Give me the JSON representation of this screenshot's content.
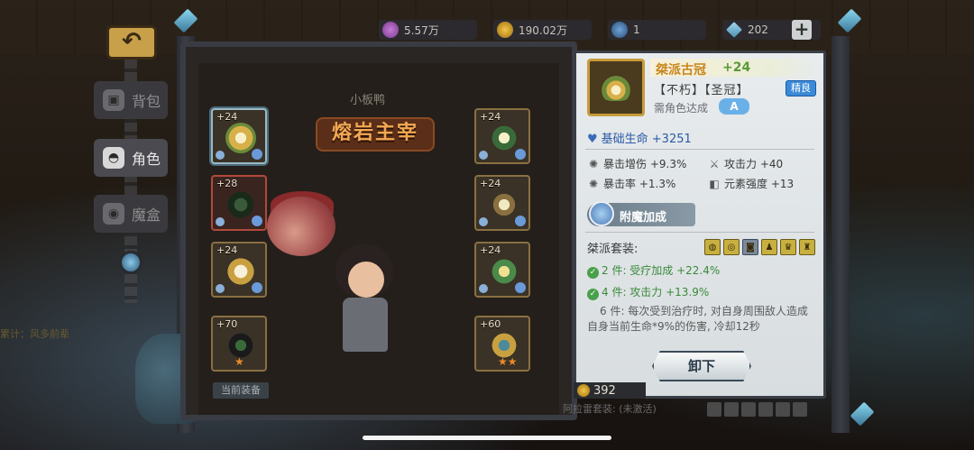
{
  "resources": [
    {
      "name": "gem-icon",
      "value": "5.57万"
    },
    {
      "name": "gold-icon",
      "value": "190.02万"
    },
    {
      "name": "orb-icon",
      "value": "1"
    },
    {
      "name": "diamond-icon",
      "value": "202"
    }
  ],
  "add_label": "+",
  "nav": {
    "back_glyph": "↶",
    "items": [
      {
        "label": "背包",
        "glyph": "▣"
      },
      {
        "label": "角色",
        "glyph": "◓"
      },
      {
        "label": "魔盒",
        "glyph": "◉"
      }
    ]
  },
  "center": {
    "hero_name": "小板鸭",
    "boss_title": "熔岩主宰",
    "current_equip": "当前装备",
    "left_hint": "累计：风多前辈",
    "slots": [
      {
        "level": "+24"
      },
      {
        "level": "+28"
      },
      {
        "level": "+24"
      },
      {
        "level": "+70",
        "stars": "★"
      },
      {
        "level": "+24"
      },
      {
        "level": "+24"
      },
      {
        "level": "+24"
      },
      {
        "level": "+60",
        "stars": "★★"
      }
    ]
  },
  "card": {
    "name": "桀派古冠",
    "level": "+24",
    "tags": "【不朽】【圣冠】",
    "quality": "精良",
    "requirement": "需角色达成",
    "requirement_badge": "A",
    "main_stat": "基础生命 +3251",
    "heart_glyph": "♥",
    "stats": [
      {
        "label": "暴击增伤 +9.3%",
        "glyph": "✺"
      },
      {
        "label": "攻击力   +40",
        "glyph": "⚔"
      },
      {
        "label": "暴击率   +1.3%",
        "glyph": "✺"
      },
      {
        "label": "元素强度 +13",
        "glyph": "◧"
      }
    ],
    "enchant": "附魔加成",
    "set_label": "桀派套装:",
    "set_icons": [
      "◍",
      "◎",
      "◙",
      "♟",
      "♛",
      "♜"
    ],
    "bonuses": [
      {
        "text": "2 件: 受疗加成 +22.4%"
      },
      {
        "text": "4 件: 攻击力 +13.9%"
      }
    ],
    "check_glyph": "✓",
    "desc": "6 件: 每次受到治疗时, 对自身周围敌人造成自身当前生命*9%的伤害, 冷却12秒",
    "unequip": "卸下",
    "price": "392",
    "bottom_text": "阿拉雷套装: (未激活)"
  }
}
